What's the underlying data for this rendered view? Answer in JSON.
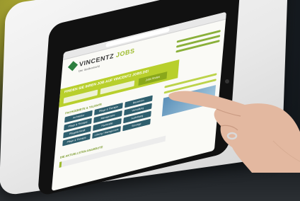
{
  "site": {
    "logo_main": "VINCENTZ",
    "logo_accent": "JOBS",
    "tagline": "Der Stellenmarkt",
    "banner_title": "FINDEN SIE IHREN JOB AUF VINCENTZ JOBS.DE!",
    "search_button": "Jobs finden",
    "section_title": "FACHGEBIETE & TALENTE",
    "bottom_title": "DIE AKTUELLSTEN ANGEBOTE",
    "tiles": [
      "Architektur",
      "Pflege & Therapie",
      "Bauwesen",
      "Pflege & Therapie",
      "Management",
      "Verwaltung",
      "Pflegefachkraft",
      "Fachkräfte",
      "Ausbildung",
      "Pflege & Therapie",
      "Leitung / Management",
      "Sonstige"
    ]
  },
  "colors": {
    "brand_green": "#9dbb2c",
    "tile_blue": "#2f5f6e",
    "banner": "#b8cf2c"
  }
}
